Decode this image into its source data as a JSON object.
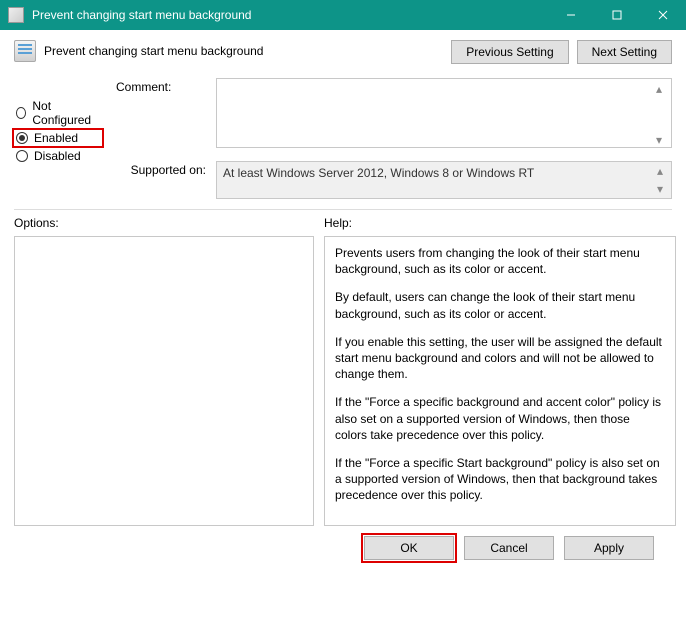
{
  "titlebar": {
    "title": "Prevent changing start menu background"
  },
  "header": {
    "policy_name": "Prevent changing start menu background",
    "prev": "Previous Setting",
    "next": "Next Setting"
  },
  "radios": {
    "not_configured": "Not Configured",
    "enabled": "Enabled",
    "disabled": "Disabled"
  },
  "labels": {
    "comment": "Comment:",
    "supported": "Supported on:",
    "options": "Options:",
    "help": "Help:"
  },
  "supported_on": "At least Windows Server 2012, Windows 8 or Windows RT",
  "help": {
    "p1": "Prevents users from changing the look of their start menu background, such as its color or accent.",
    "p2": "By default, users can change the look of their start menu background, such as its color or accent.",
    "p3": "If you enable this setting, the user will be assigned the default start menu background and colors and will not be allowed to change them.",
    "p4": "If the \"Force a specific background and accent color\" policy is also set on a supported version of Windows, then those colors take precedence over this policy.",
    "p5": "If the \"Force a specific Start background\" policy is also set on a supported version of Windows, then that background takes precedence over this policy."
  },
  "footer": {
    "ok": "OK",
    "cancel": "Cancel",
    "apply": "Apply"
  }
}
